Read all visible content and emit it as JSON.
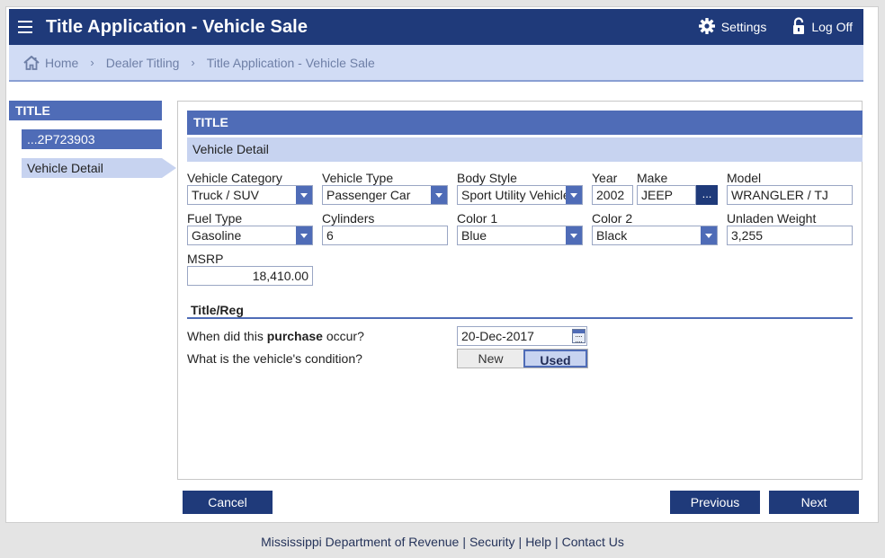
{
  "header": {
    "title": "Title Application - Vehicle Sale",
    "settings_label": "Settings",
    "logoff_label": "Log Off"
  },
  "breadcrumb": [
    "Home",
    "Dealer Titling",
    "Title Application - Vehicle Sale"
  ],
  "sidebar": {
    "heading": "TITLE",
    "items": [
      {
        "label": "...2P723903"
      },
      {
        "label": "Vehicle Detail"
      }
    ]
  },
  "panel": {
    "heading": "TITLE",
    "subheading": "Vehicle Detail"
  },
  "fields": {
    "vehicle_category": {
      "label": "Vehicle Category",
      "value": "Truck / SUV"
    },
    "vehicle_type": {
      "label": "Vehicle Type",
      "value": "Passenger Car"
    },
    "body_style": {
      "label": "Body Style",
      "value": "Sport Utility Vehicle"
    },
    "year": {
      "label": "Year",
      "value": "2002"
    },
    "make": {
      "label": "Make",
      "value": "JEEP",
      "lookup_label": "..."
    },
    "model": {
      "label": "Model",
      "value": "WRANGLER / TJ"
    },
    "fuel_type": {
      "label": "Fuel Type",
      "value": "Gasoline"
    },
    "cylinders": {
      "label": "Cylinders",
      "value": "6"
    },
    "color1": {
      "label": "Color 1",
      "value": "Blue"
    },
    "color2": {
      "label": "Color 2",
      "value": "Black"
    },
    "unladen_weight": {
      "label": "Unladen Weight",
      "value": "3,255"
    },
    "msrp": {
      "label": "MSRP",
      "value": "18,410.00"
    }
  },
  "title_reg": {
    "heading": "Title/Reg",
    "purchase_q_prefix": "When did this ",
    "purchase_q_bold": "purchase",
    "purchase_q_suffix": " occur?",
    "purchase_date": "20-Dec-2017",
    "condition_q": "What is the vehicle's condition?",
    "condition_options": [
      "New",
      "Used"
    ],
    "condition_selected": "Used"
  },
  "buttons": {
    "cancel": "Cancel",
    "previous": "Previous",
    "next": "Next"
  },
  "footer": {
    "org": "Mississippi Department of Revenue",
    "links": [
      "Security",
      "Help",
      "Contact Us"
    ]
  },
  "colors": {
    "navy": "#1f3a7a",
    "mid_blue": "#4f6cb7",
    "light_blue": "#c7d3f0"
  }
}
